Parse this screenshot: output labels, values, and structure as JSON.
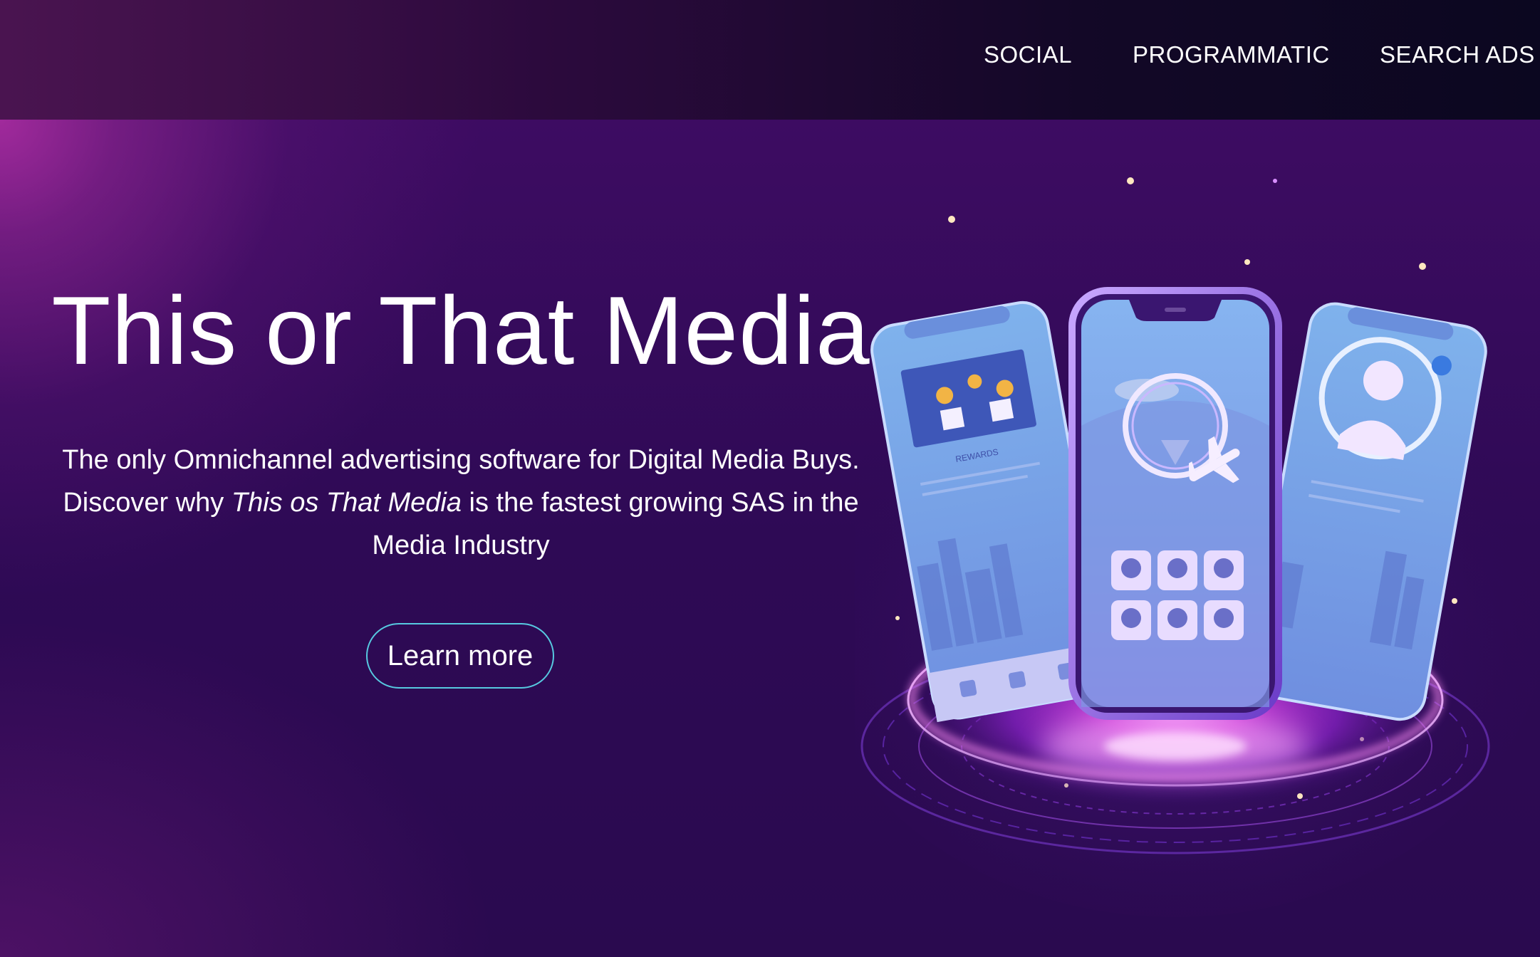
{
  "nav": {
    "items": [
      {
        "label": "SOCIAL"
      },
      {
        "label": "PROGRAMMATIC"
      },
      {
        "label": "SEARCH ADS"
      }
    ]
  },
  "hero": {
    "title": "This or That Media",
    "description_line1": "The only Omnichannel advertising software for Digital Media Buys.",
    "description_pre": "Discover why ",
    "description_brand": "This os That Media",
    "description_post": " is the fastest growing SAS in the Media Industry",
    "cta_label": "Learn more"
  },
  "illustration": {
    "left_phone_label": "REWARDS",
    "icon": "phones-on-platform-illustration"
  },
  "colors": {
    "cta_border": "#57c9e0",
    "accent_magenta": "#c040e0",
    "phone_blue": "#7aa6e8"
  }
}
